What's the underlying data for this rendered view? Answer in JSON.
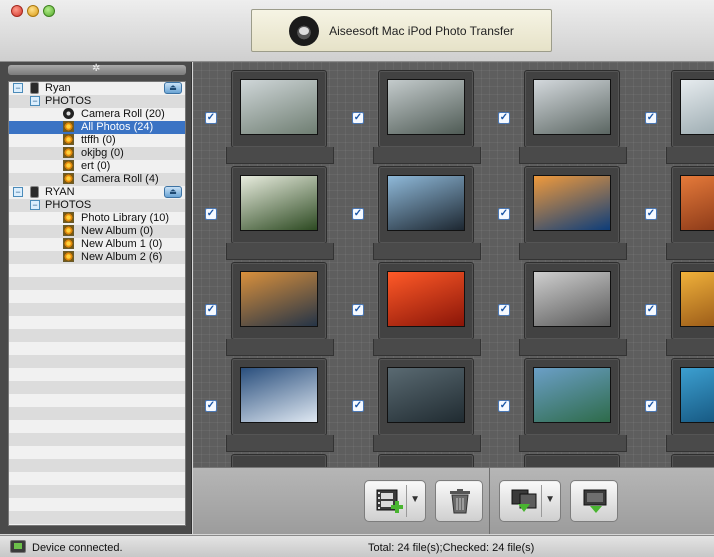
{
  "window": {
    "title": "Aiseesoft Mac iPod Photo Transfer",
    "logo": "aiseesoft-logo"
  },
  "sidebar": {
    "header_icon": "gear-icon",
    "devices": [
      {
        "name": "Ryan",
        "section": "PHOTOS",
        "albums": [
          {
            "label": "Camera Roll (20)",
            "icon": "camera-icon",
            "selected": false
          },
          {
            "label": "All Photos (24)",
            "icon": "album-icon",
            "selected": true
          },
          {
            "label": "ttffh (0)",
            "icon": "album-icon",
            "selected": false
          },
          {
            "label": "okjbg (0)",
            "icon": "album-icon",
            "selected": false
          },
          {
            "label": "ert (0)",
            "icon": "album-icon",
            "selected": false
          },
          {
            "label": "Camera Roll (4)",
            "icon": "album-icon",
            "selected": false
          }
        ]
      },
      {
        "name": "RYAN",
        "section": "PHOTOS",
        "albums": [
          {
            "label": "Photo Library (10)",
            "icon": "album-icon",
            "selected": false
          },
          {
            "label": "New Album (0)",
            "icon": "album-icon",
            "selected": false
          },
          {
            "label": "New Album 1 (0)",
            "icon": "album-icon",
            "selected": false
          },
          {
            "label": "New Album 2 (6)",
            "icon": "album-icon",
            "selected": false
          }
        ]
      }
    ]
  },
  "photos": [
    {
      "subject": "plant-by-window",
      "checked": true,
      "colors": [
        "#cfd6d8",
        "#6f7e72"
      ]
    },
    {
      "subject": "plant-by-window",
      "checked": true,
      "colors": [
        "#c4cbcc",
        "#4f5b55"
      ]
    },
    {
      "subject": "plant-by-window",
      "checked": true,
      "colors": [
        "#d3d8dc",
        "#5b6662"
      ]
    },
    {
      "subject": "plant-by-window",
      "checked": true,
      "colors": [
        "#e6ebee",
        "#8fa0a6"
      ]
    },
    {
      "subject": "white-flower",
      "checked": true,
      "colors": [
        "#e8ecde",
        "#2d4a22"
      ]
    },
    {
      "subject": "penguins",
      "checked": true,
      "colors": [
        "#8fb9d9",
        "#1d2731"
      ]
    },
    {
      "subject": "jellyfish",
      "checked": true,
      "colors": [
        "#f09a3c",
        "#0d3d7a"
      ]
    },
    {
      "subject": "desert",
      "checked": true,
      "colors": [
        "#e57a3a",
        "#7a2d12"
      ]
    },
    {
      "subject": "lighthouse",
      "checked": true,
      "colors": [
        "#d9903c",
        "#253447"
      ]
    },
    {
      "subject": "red-flower",
      "checked": true,
      "colors": [
        "#ff5a28",
        "#8a1508"
      ]
    },
    {
      "subject": "koala",
      "checked": true,
      "colors": [
        "#cfcfcf",
        "#585858"
      ]
    },
    {
      "subject": "sunset-rocks",
      "checked": true,
      "colors": [
        "#f0b13a",
        "#8a4a12"
      ]
    },
    {
      "subject": "night-sky",
      "checked": true,
      "colors": [
        "#2a4f7d",
        "#dfe8f2"
      ]
    },
    {
      "subject": "star-trails",
      "checked": true,
      "colors": [
        "#5a6a72",
        "#202b31"
      ]
    },
    {
      "subject": "mountain-lake",
      "checked": true,
      "colors": [
        "#6b9fc7",
        "#2e6b4a"
      ]
    },
    {
      "subject": "ocean",
      "checked": true,
      "colors": [
        "#3c9fd0",
        "#0f4a72"
      ]
    }
  ],
  "toolbar": {
    "buttons": [
      {
        "name": "add-photos-button",
        "icon": "film-add-icon",
        "has_menu": true
      },
      {
        "name": "delete-button",
        "icon": "trash-icon",
        "has_menu": false
      },
      {
        "name": "export-to-device-button",
        "icon": "export-icon",
        "has_menu": true
      },
      {
        "name": "export-to-mac-button",
        "icon": "import-icon",
        "has_menu": false
      }
    ]
  },
  "status": {
    "left_text": "Device connected.",
    "right_text": "Total: 24 file(s);Checked: 24 file(s)"
  }
}
